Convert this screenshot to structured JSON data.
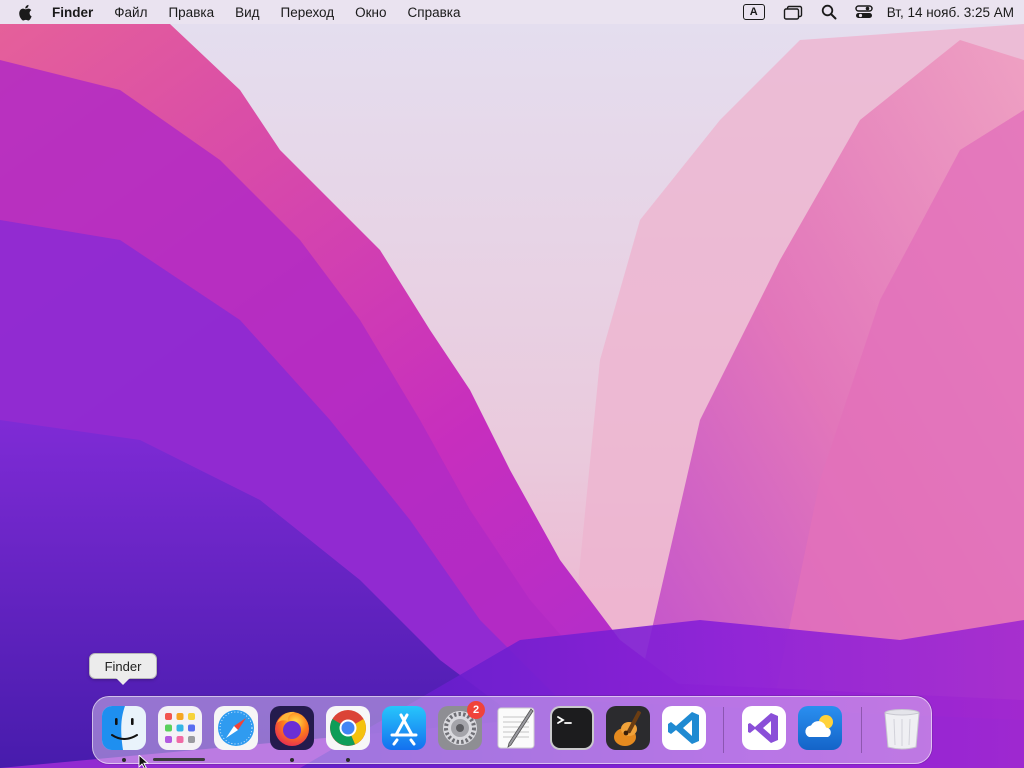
{
  "menubar": {
    "app_name": "Finder",
    "items": [
      "Файл",
      "Правка",
      "Вид",
      "Переход",
      "Окно",
      "Справка"
    ],
    "input_source": "A",
    "clock": "Вт, 14 нояб. 3:25 AM"
  },
  "tooltip": {
    "text": "Finder"
  },
  "dock": {
    "items": [
      {
        "name": "Finder",
        "icon": "finder-icon",
        "running": true
      },
      {
        "name": "Launchpad",
        "icon": "launchpad-icon",
        "running": false
      },
      {
        "name": "Safari",
        "icon": "safari-icon",
        "running": false
      },
      {
        "name": "Firefox",
        "icon": "firefox-icon",
        "running": true
      },
      {
        "name": "Chrome",
        "icon": "chrome-icon",
        "running": true
      },
      {
        "name": "App Store",
        "icon": "app-store-icon",
        "running": false
      },
      {
        "name": "System Settings",
        "icon": "system-settings-icon",
        "running": false,
        "badge": "2"
      },
      {
        "name": "TextEdit",
        "icon": "textedit-icon",
        "running": false
      },
      {
        "name": "Terminal",
        "icon": "terminal-icon",
        "running": false
      },
      {
        "name": "GarageBand",
        "icon": "garageband-icon",
        "running": false
      },
      {
        "name": "Visual Studio Code",
        "icon": "vscode-icon",
        "running": false
      },
      {
        "name": "Visual Studio",
        "icon": "visual-studio-icon",
        "running": false
      },
      {
        "name": "Weather",
        "icon": "weather-icon",
        "running": false
      },
      {
        "name": "Trash",
        "icon": "trash-icon",
        "running": false
      }
    ]
  },
  "colors": {
    "accent_badge": "#f0433a",
    "menubar_bg": "#ece4f0"
  }
}
